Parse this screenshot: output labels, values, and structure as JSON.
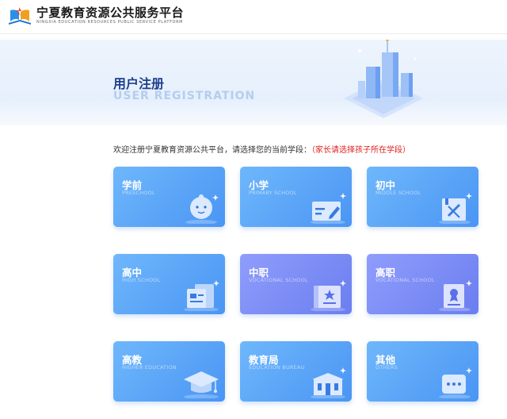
{
  "header": {
    "title_cn": "宁夏教育资源公共服务平台",
    "title_en": "NINGXIA EDUCATION RESOURCES PUBLIC SERVICE PLATFORM"
  },
  "banner": {
    "title_cn": "用户注册",
    "title_en": "USER REGISTRATION"
  },
  "intro": {
    "text": "欢迎注册宁夏教育资源公共平台，请选择您的当前学段：",
    "note": "（家长请选择孩子所在学段）"
  },
  "colors": {
    "card_blue": "#4a95f4",
    "card_violet": "#6b7ef0",
    "note_red": "#e02020",
    "title_navy": "#1f3f8c"
  },
  "stages": [
    {
      "cn": "学前",
      "en": "PRESCHOOL",
      "icon": "baby-face-icon"
    },
    {
      "cn": "小学",
      "en": "PRIMARY SCHOOL",
      "icon": "pencil-card-icon"
    },
    {
      "cn": "初中",
      "en": "MIDDLE SCHOOL",
      "icon": "ruler-pencil-icon"
    },
    {
      "cn": "高中",
      "en": "HIGH SCHOOL",
      "icon": "document-icon"
    },
    {
      "cn": "中职",
      "en": "VOCATIONAL SCHOOL",
      "icon": "certificate-icon"
    },
    {
      "cn": "高职",
      "en": "VOCATIONAL SCHOOL",
      "icon": "award-certificate-icon"
    },
    {
      "cn": "高教",
      "en": "HIGHER EDUCATION",
      "icon": "graduation-cap-icon"
    },
    {
      "cn": "教育局",
      "en": "EDUCATION BUREAU",
      "icon": "building-icon"
    },
    {
      "cn": "其他",
      "en": "OTHERS",
      "icon": "chat-bubble-icon"
    }
  ]
}
